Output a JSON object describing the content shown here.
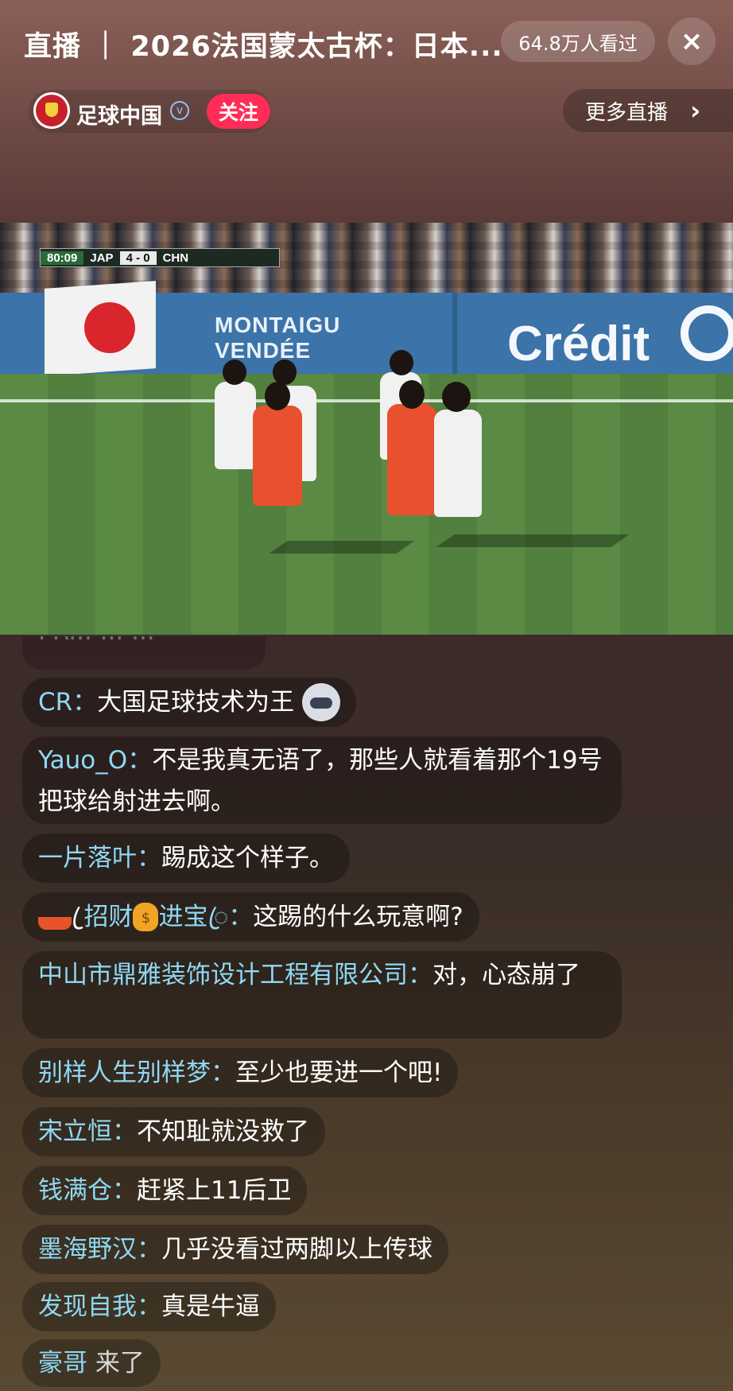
{
  "header": {
    "title": "直播 ｜ 2026法国蒙太古杯：日本...",
    "viewers": "64.8万人看过",
    "close_icon": "×"
  },
  "channel": {
    "name": "足球中国",
    "verified_icon": "verified-badge-icon",
    "follow_label": "关注",
    "more_live_label": "更多直播",
    "more_live_chevron": "›"
  },
  "video": {
    "scorebug": {
      "time": "80:09",
      "home": "JAP",
      "score": "4 - 0",
      "away": "CHN"
    },
    "board_left": "MONTAIGU",
    "board_left_2": "VENDÉE",
    "board_right": "Crédit"
  },
  "chat": {
    "faded_top": "FR... ... ...",
    "messages": [
      {
        "user": "CR",
        "text": "大国足球技术为王",
        "emoji": "wolf"
      },
      {
        "user": "Yauo_O",
        "text": "不是我真无语了，那些人就看着那个19号把球给射进去啊。"
      },
      {
        "user": "一片落叶",
        "text": "踢成这个样子。"
      },
      {
        "user_prefix": "ꦿ招财",
        "user_mid": "进宝ꦿ",
        "text": "这踢的什么玩意啊?"
      },
      {
        "user": "中山市鼎雅装饰设计工程有限公司",
        "text": "对，心态崩了"
      },
      {
        "user": "别样人生别样梦",
        "text": "至少也要进一个吧!"
      },
      {
        "user": "宋立恒",
        "text": "不知耻就没救了"
      },
      {
        "user": "钱满仓",
        "text": "赶紧上11后卫"
      },
      {
        "user": "墨海野汉",
        "text": "几乎没看过两脚以上传球"
      },
      {
        "user": "发现自我",
        "text": "真是牛逼"
      },
      {
        "user": "豪哥",
        "text": "来了"
      }
    ]
  },
  "colors": {
    "follow": "#ff2d55",
    "username": "#8fd8f4",
    "verified": "#8fc4ff"
  }
}
